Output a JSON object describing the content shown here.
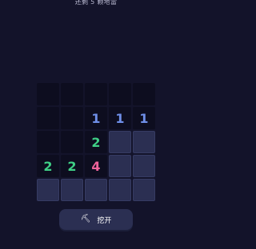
{
  "status": {
    "remaining_text": "还剩 5 颗地雷"
  },
  "board": {
    "rows": 5,
    "cols": 5,
    "cells": [
      [
        {
          "state": "revealed",
          "value": ""
        },
        {
          "state": "revealed",
          "value": ""
        },
        {
          "state": "revealed",
          "value": ""
        },
        {
          "state": "revealed",
          "value": ""
        },
        {
          "state": "revealed",
          "value": ""
        }
      ],
      [
        {
          "state": "revealed",
          "value": ""
        },
        {
          "state": "revealed",
          "value": ""
        },
        {
          "state": "revealed",
          "value": "1"
        },
        {
          "state": "revealed",
          "value": "1"
        },
        {
          "state": "revealed",
          "value": "1"
        }
      ],
      [
        {
          "state": "revealed",
          "value": ""
        },
        {
          "state": "revealed",
          "value": ""
        },
        {
          "state": "revealed",
          "value": "2"
        },
        {
          "state": "hidden",
          "value": ""
        },
        {
          "state": "hidden",
          "value": ""
        }
      ],
      [
        {
          "state": "revealed",
          "value": "2"
        },
        {
          "state": "revealed",
          "value": "2"
        },
        {
          "state": "revealed",
          "value": "4"
        },
        {
          "state": "hidden",
          "value": ""
        },
        {
          "state": "hidden",
          "value": ""
        }
      ],
      [
        {
          "state": "hidden",
          "value": ""
        },
        {
          "state": "hidden",
          "value": ""
        },
        {
          "state": "hidden",
          "value": ""
        },
        {
          "state": "hidden",
          "value": ""
        },
        {
          "state": "hidden",
          "value": ""
        }
      ]
    ]
  },
  "number_colors": {
    "1": "#6f8fe8",
    "2": "#3fcf86",
    "4": "#f0639b"
  },
  "action": {
    "icon": "pickaxe-icon",
    "label": "挖开"
  }
}
